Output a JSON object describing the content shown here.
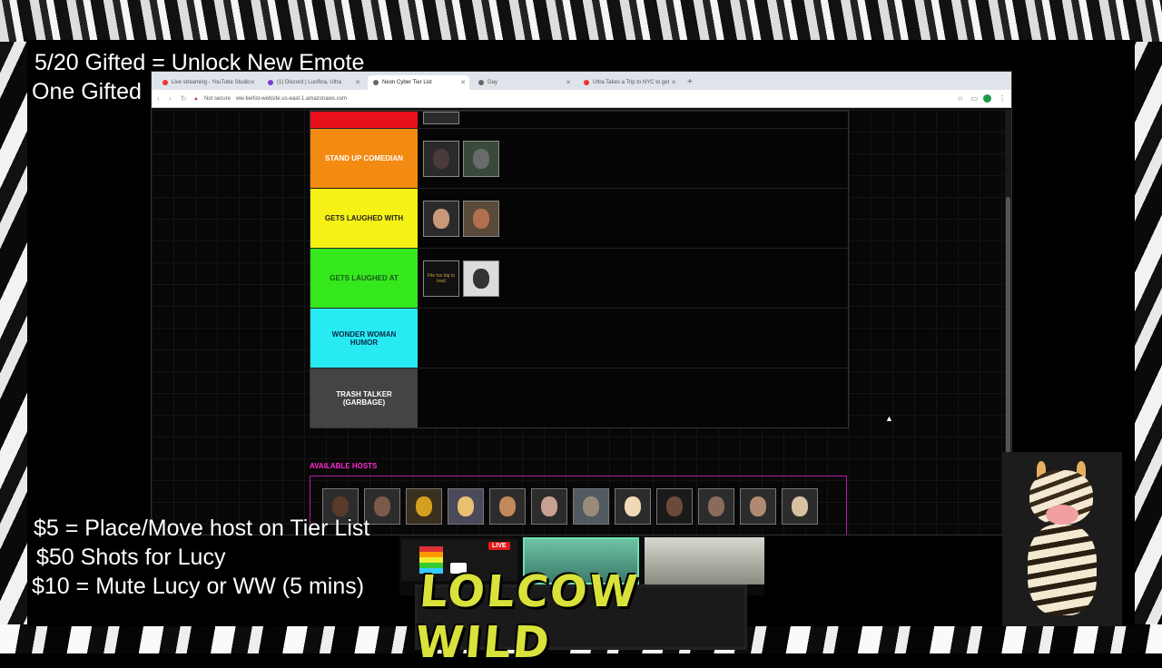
{
  "overlay": {
    "line1": "5/20 Gifted = Unlock New Emote",
    "line2": "One Gifted",
    "price1": "$5 = Place/Move host on Tier List",
    "price2": "$50 Shots for Lucy",
    "price3": "$10 = Mute Lucy or WW (5 mins)"
  },
  "browser": {
    "tabs": [
      {
        "label": "Live streaming - YouTube Studio",
        "active": false
      },
      {
        "label": "(1) Discord | Lucifina, Ultra",
        "active": false
      },
      {
        "label": "Neon Cyber Tier List",
        "active": true
      },
      {
        "label": "Gay",
        "active": false
      },
      {
        "label": "Ultra Takes a Trip to NYC to get",
        "active": false
      }
    ],
    "not_secure": "Not secure",
    "url": "ww-tierlist-website.us-east-1.amazonaws.com"
  },
  "tiers": [
    {
      "label": "",
      "color": "#e8101a",
      "partial": true
    },
    {
      "label": "STAND UP COMEDIAN",
      "color": "#f38a12",
      "text_color": "#ffffff"
    },
    {
      "label": "GETS LAUGHED WITH",
      "color": "#f7f215",
      "text_color": "#222222"
    },
    {
      "label": "GETS LAUGHED AT",
      "color": "#34e81c",
      "text_color": "#1a5a1a"
    },
    {
      "label": "WONDER WOMAN HUMOR",
      "color": "#28eaf2",
      "text_color": "#0b2a44"
    },
    {
      "label": "TRASH TALKER (GARBAGE)",
      "color": "#444444",
      "text_color": "#ffffff"
    }
  ],
  "placeholder_text": "File too big to load",
  "available_hosts_title": "AVAILABLE HOSTS",
  "live_badge": "LIVE",
  "logo_text": "LOLCOW WILD",
  "colors": {
    "accent_pink": "#ff2bd6",
    "logo_yellow": "#d8e23a"
  }
}
